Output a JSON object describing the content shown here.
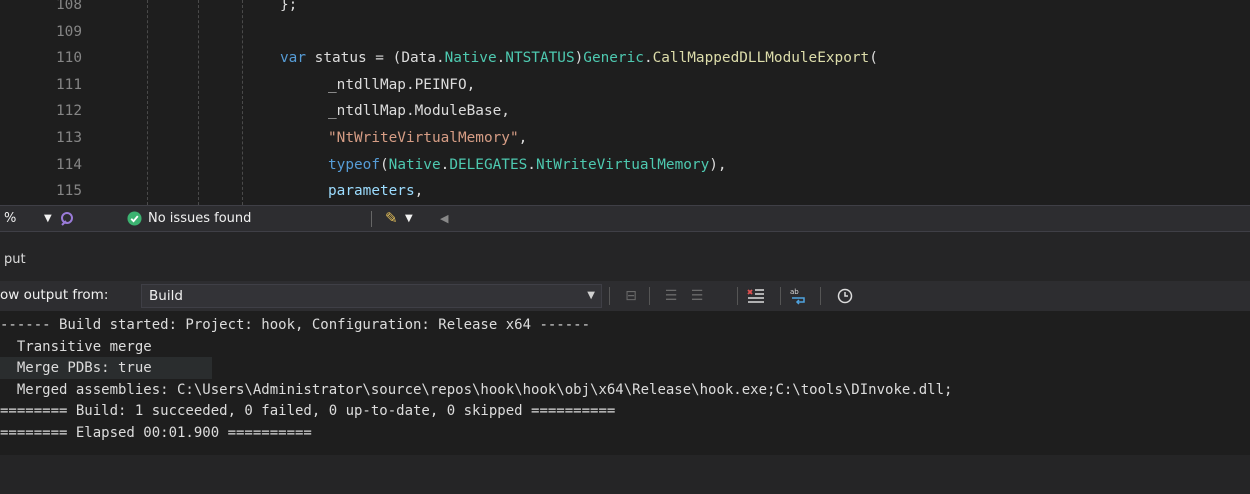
{
  "editor": {
    "lines": [
      {
        "num": "108",
        "tokens": [
          {
            "t": "};",
            "c": "pl"
          }
        ]
      },
      {
        "num": "109",
        "tokens": []
      },
      {
        "num": "110",
        "tokens": [
          {
            "t": "var",
            "c": "kw"
          },
          {
            "t": " status = (",
            "c": "pl"
          },
          {
            "t": "Data",
            "c": "pl"
          },
          {
            "t": ".",
            "c": "pl"
          },
          {
            "t": "Native",
            "c": "ty"
          },
          {
            "t": ".",
            "c": "pl"
          },
          {
            "t": "NTSTATUS",
            "c": "ty"
          },
          {
            "t": ")",
            "c": "pl"
          },
          {
            "t": "Generic",
            "c": "ty"
          },
          {
            "t": ".",
            "c": "pl"
          },
          {
            "t": "CallMappedDLLModuleExport",
            "c": "fn"
          },
          {
            "t": "(",
            "c": "pl"
          }
        ]
      },
      {
        "num": "111",
        "tokens": [
          {
            "t": "_ntdllMap.PEINFO,",
            "c": "pl"
          }
        ]
      },
      {
        "num": "112",
        "tokens": [
          {
            "t": "_ntdllMap.ModuleBase,",
            "c": "pl"
          }
        ]
      },
      {
        "num": "113",
        "tokens": [
          {
            "t": "\"NtWriteVirtualMemory\"",
            "c": "str"
          },
          {
            "t": ",",
            "c": "pl"
          }
        ]
      },
      {
        "num": "114",
        "tokens": [
          {
            "t": "typeof",
            "c": "kw"
          },
          {
            "t": "(",
            "c": "pl"
          },
          {
            "t": "Native",
            "c": "ty"
          },
          {
            "t": ".",
            "c": "pl"
          },
          {
            "t": "DELEGATES",
            "c": "ty"
          },
          {
            "t": ".",
            "c": "pl"
          },
          {
            "t": "NtWriteVirtualMemory",
            "c": "ty"
          },
          {
            "t": "),",
            "c": "pl"
          }
        ]
      },
      {
        "num": "115",
        "tokens": [
          {
            "t": "parameters",
            "c": "var"
          },
          {
            "t": ",",
            "c": "pl"
          }
        ]
      }
    ]
  },
  "status_strip": {
    "zoom": "%",
    "issues_text": "No issues found",
    "ok_color": "#3cb371"
  },
  "output": {
    "title": "put",
    "source_label": "ow output from:",
    "source_value": "Build",
    "toolbar_icons": [
      "find-message-icon",
      "prev-message-icon",
      "next-message-icon",
      "clear-all-icon",
      "word-wrap-icon",
      "clock-icon"
    ],
    "lines": [
      "------ Build started: Project: hook, Configuration: Release x64 ------",
      "  Transitive merge",
      "  Merge PDBs: true",
      "  Merged assemblies: C:\\Users\\Administrator\\source\\repos\\hook\\hook\\obj\\x64\\Release\\hook.exe;C:\\tools\\DInvoke.dll;",
      "======== Build: 1 succeeded, 0 failed, 0 up-to-date, 0 skipped ==========",
      "======== Elapsed 00:01.900 =========="
    ]
  }
}
